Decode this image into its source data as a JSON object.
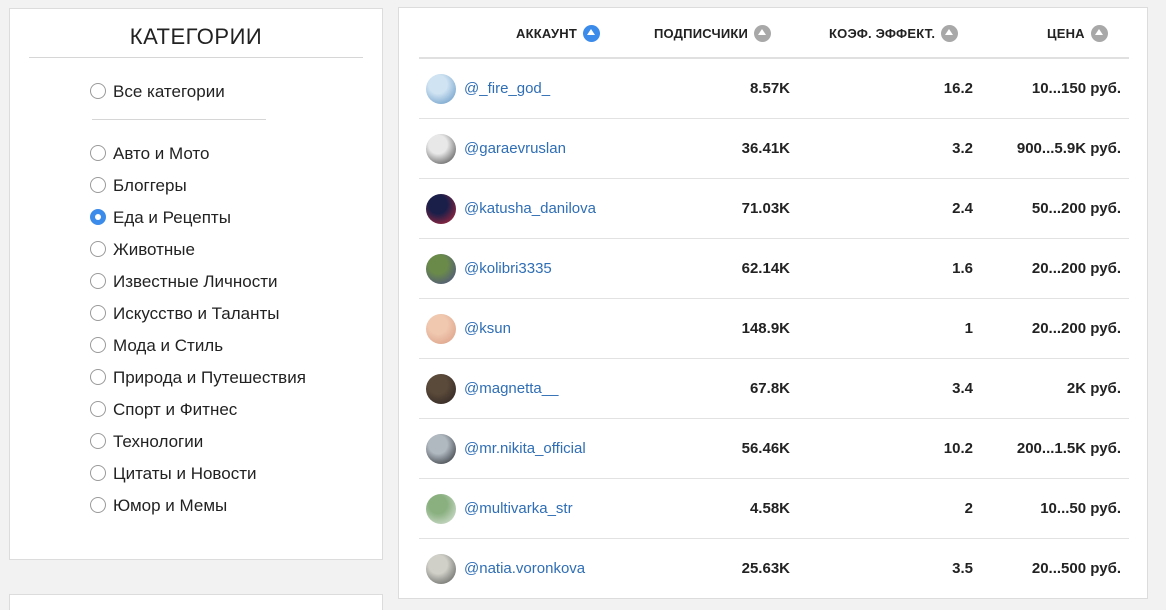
{
  "sidebar": {
    "title": "КАТЕГОРИИ",
    "all_label": "Все категории",
    "categories": [
      {
        "label": "Авто и Мото",
        "checked": false
      },
      {
        "label": "Блоггеры",
        "checked": false
      },
      {
        "label": "Еда и Рецепты",
        "checked": true
      },
      {
        "label": "Животные",
        "checked": false
      },
      {
        "label": "Известные Личности",
        "checked": false
      },
      {
        "label": "Искусство и Таланты",
        "checked": false
      },
      {
        "label": "Мода и Стиль",
        "checked": false
      },
      {
        "label": "Природа и Путешествия",
        "checked": false
      },
      {
        "label": "Спорт и Фитнес",
        "checked": false
      },
      {
        "label": "Технологии",
        "checked": false
      },
      {
        "label": "Цитаты и Новости",
        "checked": false
      },
      {
        "label": "Юмор и Мемы",
        "checked": false
      }
    ]
  },
  "table": {
    "headers": {
      "account": "АККАУНТ",
      "followers": "ПОДПИСЧИКИ",
      "coef": "КОЭФ. ЭФФЕКТ.",
      "price": "ЦЕНА"
    },
    "sort_active": "account",
    "colors": {
      "sort_active": "#3b8beb",
      "sort_inactive": "#a8a8a8",
      "link": "#2f6eb5"
    },
    "rows": [
      {
        "handle": "@_fire_god_",
        "followers": "8.57K",
        "coef": "16.2",
        "price": "10...150 руб.",
        "avatar": [
          "#cfe3f2",
          "#5a8fc0"
        ]
      },
      {
        "handle": "@garaevruslan",
        "followers": "36.41K",
        "coef": "3.2",
        "price": "900...5.9K руб.",
        "avatar": [
          "#e8e8e8",
          "#3a3a3a"
        ]
      },
      {
        "handle": "@katusha_danilova",
        "followers": "71.03K",
        "coef": "2.4",
        "price": "50...200 руб.",
        "avatar": [
          "#1a1f4a",
          "#c0283a"
        ]
      },
      {
        "handle": "@kolibri3335",
        "followers": "62.14K",
        "coef": "1.6",
        "price": "20...200 руб.",
        "avatar": [
          "#6a8a4a",
          "#4a4a8a"
        ]
      },
      {
        "handle": "@ksun",
        "followers": "148.9K",
        "coef": "1",
        "price": "20...200 руб.",
        "avatar": [
          "#f0c8b0",
          "#d89a80"
        ]
      },
      {
        "handle": "@magnetta__",
        "followers": "67.8K",
        "coef": "3.4",
        "price": "2K руб.",
        "avatar": [
          "#5a4a3a",
          "#2a2020"
        ]
      },
      {
        "handle": "@mr.nikita_official",
        "followers": "56.46K",
        "coef": "10.2",
        "price": "200...1.5K руб.",
        "avatar": [
          "#b0b8c0",
          "#202428"
        ]
      },
      {
        "handle": "@multivarka_str",
        "followers": "4.58K",
        "coef": "2",
        "price": "10...50 руб.",
        "avatar": [
          "#8ab080",
          "#e0e8e0"
        ]
      },
      {
        "handle": "@natia.voronkova",
        "followers": "25.63K",
        "coef": "3.5",
        "price": "20...500 руб.",
        "avatar": [
          "#d0d0c8",
          "#505050"
        ]
      }
    ]
  }
}
